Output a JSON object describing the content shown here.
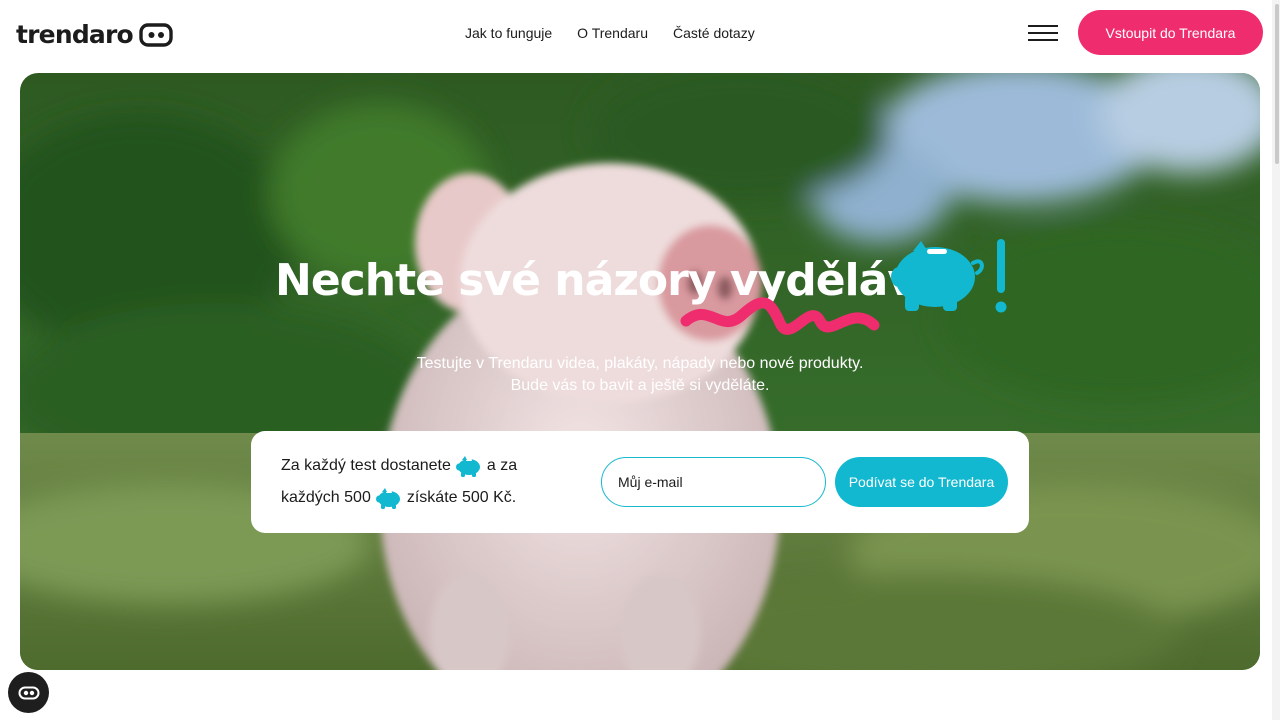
{
  "header": {
    "logo_text": "trendaro",
    "nav": [
      "Jak to funguje",
      "O Trendaru",
      "Časté dotazy"
    ],
    "menu_icon": "hamburger-menu-icon",
    "cta_label": "Vstoupit do Trendara"
  },
  "hero": {
    "headline": "Nechte své názory vydělávat",
    "headline_icon": "piggy-bank-icon",
    "headline_suffix": "!",
    "subtitle_line1": "Testujte v Trendaru videa, plakáty, nápady nebo nové produkty.",
    "subtitle_line2": "Bude vás to bavit a ještě si vyděláte."
  },
  "signup": {
    "text_part1": "Za každý test dostanete",
    "text_part2": "a za",
    "text_part3": "každých 500",
    "text_part4": "získáte 500 Kč.",
    "email_placeholder": "Můj e-mail",
    "submit_label": "Podívat se do Trendara"
  },
  "cookie_button_icon": "cookie-settings-icon",
  "colors": {
    "brand_pink": "#ef2d6e",
    "brand_cyan": "#12b8cf",
    "text_dark": "#1c1c1c"
  }
}
